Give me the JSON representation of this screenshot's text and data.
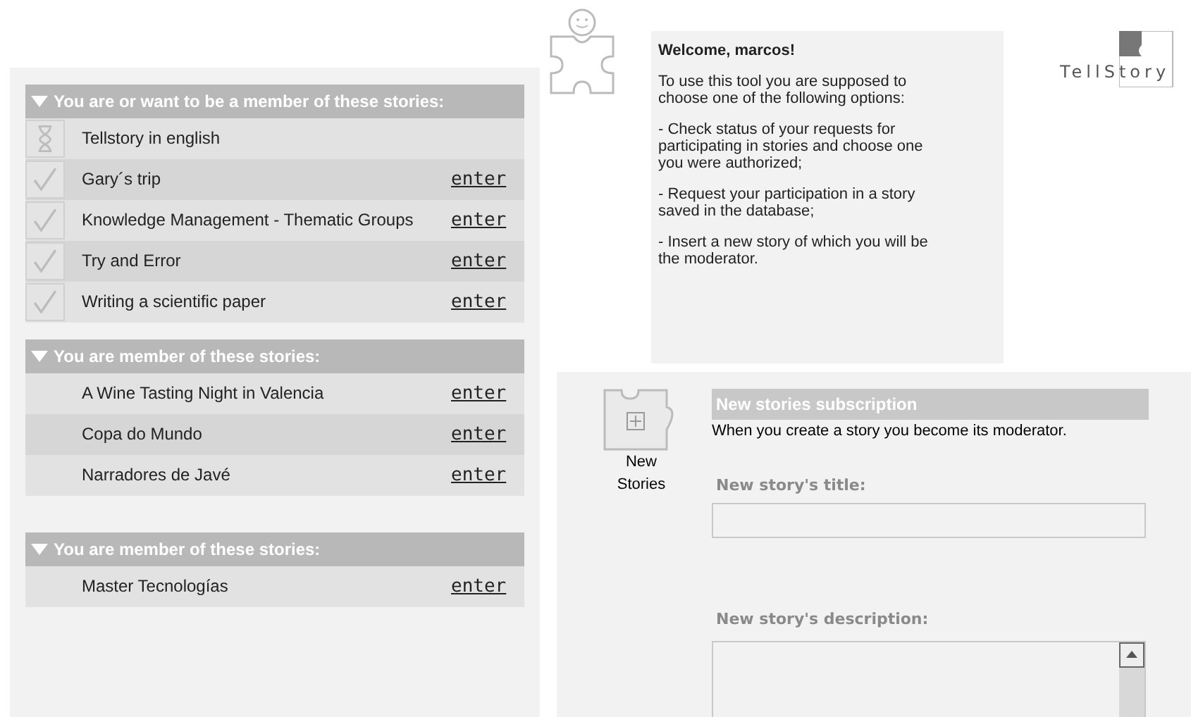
{
  "sections": [
    {
      "title": "You are or want to be a member of these stories:",
      "expanded": true,
      "rows": [
        {
          "kind": "pending",
          "name": "Tellstory in english"
        },
        {
          "kind": "authorized",
          "name": "Gary´s trip",
          "link": "enter"
        },
        {
          "kind": "authorized",
          "name": "Knowledge Management - Thematic Groups",
          "link": "enter"
        },
        {
          "kind": "authorized",
          "name": "Try and Error",
          "link": "enter"
        },
        {
          "kind": "authorized",
          "name": "Writing a scientific paper",
          "link": "enter"
        }
      ]
    },
    {
      "title": "You are member of these stories:",
      "expanded": true,
      "rows": [
        {
          "kind": "plain",
          "name": "A Wine Tasting Night in Valencia",
          "link": "enter"
        },
        {
          "kind": "plain",
          "name": "Copa do Mundo",
          "link": "enter"
        },
        {
          "kind": "plain",
          "name": "Narradores de Javé",
          "link": "enter"
        }
      ]
    },
    {
      "title": "You are member of these stories:",
      "expanded": true,
      "rows": [
        {
          "kind": "plain",
          "name": "Master Tecnologías",
          "link": "enter"
        }
      ]
    }
  ],
  "welcome": {
    "heading": "Welcome, marcos!",
    "paragraphs": [
      "To use this tool you are supposed to choose one of the following options:",
      "- Check status of your requests for participating in stories and choose one you were authorized;",
      "- Request your participation in a story saved in the database;",
      "- Insert a new story of which you will be the moderator."
    ]
  },
  "logo": {
    "left": "Tell",
    "right": "Story"
  },
  "new_story": {
    "icon_label": "New Stories",
    "header": "New stories subscription",
    "note": "When you create a story you become its moderator.",
    "title_label": "New story's title:",
    "description_label": "New story's description:"
  }
}
